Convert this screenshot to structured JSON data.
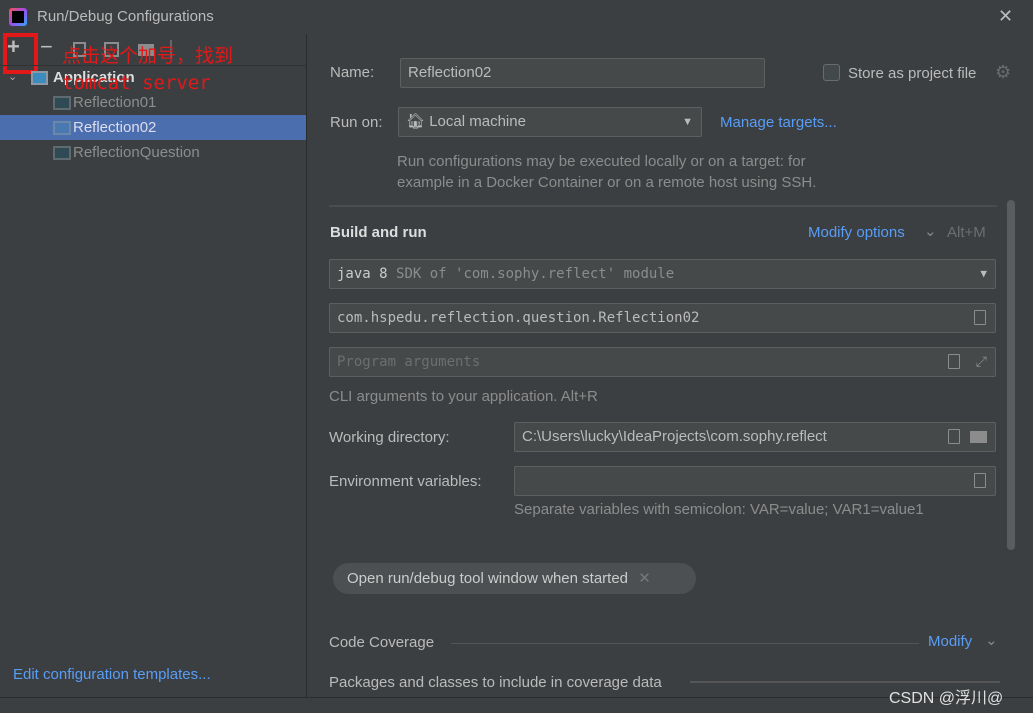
{
  "window": {
    "title": "Run/Debug Configurations",
    "close": "✕"
  },
  "toolbar": {
    "add": "+",
    "remove": "−"
  },
  "annotation": {
    "line1": "点击这个加号，找到",
    "line2": "tomcat server",
    "color": "#e31818"
  },
  "tree": {
    "group": "Application",
    "items": [
      "Reflection01",
      "Reflection02",
      "ReflectionQuestion"
    ],
    "selected": 1
  },
  "left_footer": {
    "templates_link": "Edit configuration templates..."
  },
  "form": {
    "name_label": "Name:",
    "name_value": "Reflection02",
    "store_label": "Store as project file",
    "store_checked": false,
    "run_on_label": "Run on:",
    "run_on_value": "Local machine",
    "manage_targets": "Manage targets...",
    "run_on_hint1": "Run configurations may be executed locally or on a target: for",
    "run_on_hint2": "example in a Docker Container or on a remote host using SSH.",
    "build_title": "Build and run",
    "modify_options": "Modify options",
    "modify_shortcut": "Alt+M",
    "sdk_java": "java 8",
    "sdk_rest": "SDK of 'com.sophy.reflect' module",
    "main_class": "com.hspedu.reflection.question.Reflection02",
    "program_args_placeholder": "Program arguments",
    "cli_hint": "CLI arguments to your application. Alt+R",
    "workdir_label": "Working directory:",
    "workdir_value": "C:\\Users\\lucky\\IdeaProjects\\com.sophy.reflect",
    "env_label": "Environment variables:",
    "env_value": "",
    "env_hint": "Separate variables with semicolon: VAR=value; VAR1=value1",
    "chip": "Open run/debug tool window when started",
    "coverage_title": "Code Coverage",
    "coverage_modify": "Modify",
    "packages_label": "Packages and classes to include in coverage data"
  },
  "watermark": "CSDN @浮川@",
  "colors": {
    "accent": "#589df6",
    "selection": "#4b6eaf",
    "background": "#3c3f41"
  }
}
